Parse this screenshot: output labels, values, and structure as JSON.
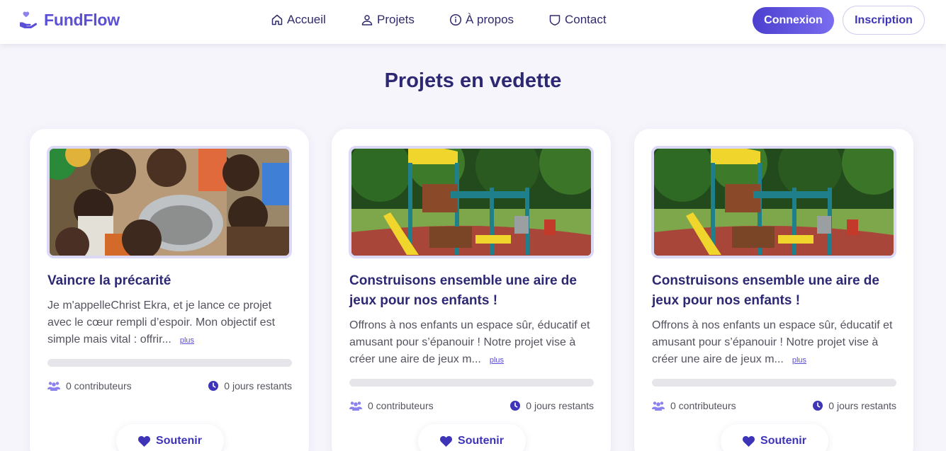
{
  "brand": {
    "name": "FundFlow",
    "color": "#5b4fd8"
  },
  "nav": {
    "items": [
      {
        "label": "Accueil",
        "icon": "home-icon"
      },
      {
        "label": "Projets",
        "icon": "user-icon"
      },
      {
        "label": "À propos",
        "icon": "info-icon"
      },
      {
        "label": "Contact",
        "icon": "shield-icon"
      }
    ],
    "login_label": "Connexion",
    "signup_label": "Inscription"
  },
  "section": {
    "title": "Projets en vedette"
  },
  "projects": [
    {
      "title": "Vaincre la précarité",
      "description": "Je m'appelleChrist Ekra, et je lance ce projet avec le cœur rempli d’espoir. Mon objectif est simple mais vital : offrir...",
      "more_label": "plus",
      "progress": 0,
      "contributors": "0 contributeurs",
      "days_left": "0 jours restants",
      "support_label": "Soutenir",
      "image": "children-eating-photo"
    },
    {
      "title": "Construisons ensemble une aire de jeux pour nos enfants !",
      "description": "Offrons à nos enfants un espace sûr, éducatif et amusant pour s’épanouir ! Notre projet vise à créer une aire de jeux m...",
      "more_label": "plus",
      "progress": 0,
      "contributors": "0 contributeurs",
      "days_left": "0 jours restants",
      "support_label": "Soutenir",
      "image": "playground-photo"
    },
    {
      "title": "Construisons ensemble une aire de jeux pour nos enfants !",
      "description": "Offrons à nos enfants un espace sûr, éducatif et amusant pour s’épanouir ! Notre projet vise à créer une aire de jeux m...",
      "more_label": "plus",
      "progress": 0,
      "contributors": "0 contributeurs",
      "days_left": "0 jours restants",
      "support_label": "Soutenir",
      "image": "playground-photo"
    }
  ]
}
